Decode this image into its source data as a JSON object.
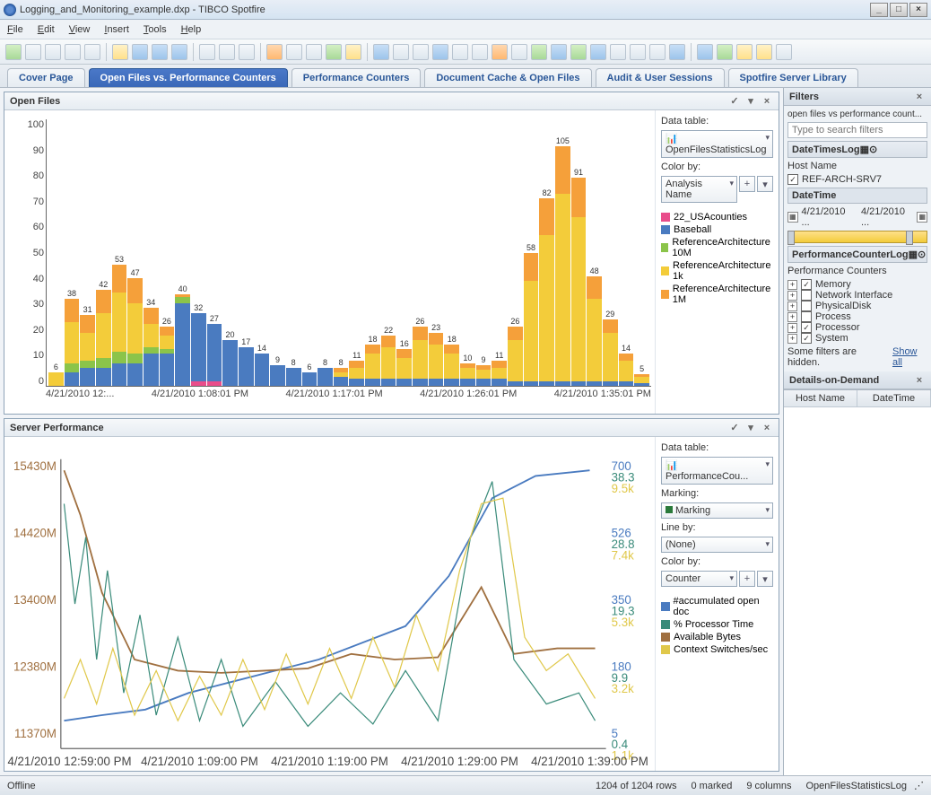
{
  "window": {
    "title": "Logging_and_Monitoring_example.dxp - TIBCO Spotfire"
  },
  "menu": {
    "items": [
      "File",
      "Edit",
      "View",
      "Insert",
      "Tools",
      "Help"
    ]
  },
  "tabs": {
    "items": [
      "Cover Page",
      "Open Files vs. Performance Counters",
      "Performance Counters",
      "Document Cache & Open Files",
      "Audit & User Sessions",
      "Spotfire Server Library"
    ],
    "active": 1
  },
  "panel_top": {
    "title": "Open Files",
    "data_table_label": "Data table:",
    "data_table": "OpenFilesStatisticsLog",
    "color_by_label": "Color by:",
    "color_by": "Analysis Name",
    "legend": [
      "22_USAcounties",
      "Baseball",
      "ReferenceArchitecture 10M",
      "ReferenceArchitecture 1k",
      "ReferenceArchitecture 1M"
    ]
  },
  "panel_bot": {
    "title": "Server Performance",
    "data_table_label": "Data table:",
    "data_table": "PerformanceCou...",
    "marking_label": "Marking:",
    "marking": "Marking",
    "line_by_label": "Line by:",
    "line_by": "(None)",
    "color_by_label": "Color by:",
    "color_by": "Counter",
    "legend": [
      "#accumulated open doc",
      "% Processor Time",
      "Available Bytes",
      "Context Switches/sec"
    ]
  },
  "filters": {
    "title": "Filters",
    "scheme": "open files vs performance count...",
    "search_placeholder": "Type to search filters",
    "group1": "DateTimesLog",
    "hostname_label": "Host Name",
    "hostname": "REF-ARCH-SRV7",
    "datetime_label": "DateTime",
    "date_from": "4/21/2010 ...",
    "date_to": "4/21/2010 ...",
    "group2": "PerformanceCounterLog",
    "counters_label": "Performance Counters",
    "counters": [
      {
        "label": "Memory",
        "checked": true
      },
      {
        "label": "Network Interface",
        "checked": false
      },
      {
        "label": "PhysicalDisk",
        "checked": false
      },
      {
        "label": "Process",
        "checked": false
      },
      {
        "label": "Processor",
        "checked": true
      },
      {
        "label": "System",
        "checked": true
      }
    ],
    "hidden_msg": "Some filters are hidden.",
    "show_all": "Show all"
  },
  "dod": {
    "title": "Details-on-Demand",
    "cols": [
      "Host Name",
      "DateTime"
    ]
  },
  "status": {
    "offline": "Offline",
    "rows": "1204 of 1204 rows",
    "marked": "0 marked",
    "columns": "9 columns",
    "table": "OpenFilesStatisticsLog"
  },
  "chart_data": [
    {
      "type": "bar",
      "title": "Open Files",
      "ylim": [
        0,
        110
      ],
      "yticks": [
        0,
        10,
        20,
        30,
        40,
        50,
        60,
        70,
        80,
        90,
        100
      ],
      "xticks": [
        "4/21/2010 12:...",
        "4/21/2010 1:08:01 PM",
        "4/21/2010 1:17:01 PM",
        "4/21/2010 1:26:01 PM",
        "4/21/2010 1:35:01 PM"
      ],
      "legend": [
        "22_USAcounties",
        "Baseball",
        "ReferenceArchitecture 10M",
        "ReferenceArchitecture 1k",
        "ReferenceArchitecture 1M"
      ],
      "bars": [
        {
          "total": 6,
          "segs": [
            0,
            0,
            0,
            6,
            0
          ]
        },
        {
          "total": 38,
          "segs": [
            0,
            6,
            4,
            18,
            10
          ]
        },
        {
          "total": 31,
          "segs": [
            0,
            8,
            3,
            12,
            8
          ]
        },
        {
          "total": 42,
          "segs": [
            0,
            8,
            4,
            20,
            10
          ]
        },
        {
          "total": 53,
          "segs": [
            0,
            10,
            5,
            26,
            12
          ]
        },
        {
          "total": 47,
          "segs": [
            0,
            10,
            4,
            22,
            11
          ]
        },
        {
          "total": 34,
          "segs": [
            0,
            14,
            3,
            10,
            7
          ]
        },
        {
          "total": 26,
          "segs": [
            0,
            14,
            2,
            6,
            4
          ]
        },
        {
          "total": 40,
          "segs": [
            0,
            36,
            3,
            0,
            1
          ]
        },
        {
          "total": 32,
          "segs": [
            2,
            30,
            0,
            0,
            0
          ]
        },
        {
          "total": 27,
          "segs": [
            2,
            25,
            0,
            0,
            0
          ]
        },
        {
          "total": 20,
          "segs": [
            0,
            20,
            0,
            0,
            0
          ]
        },
        {
          "total": 17,
          "segs": [
            0,
            17,
            0,
            0,
            0
          ]
        },
        {
          "total": 14,
          "segs": [
            0,
            14,
            0,
            0,
            0
          ]
        },
        {
          "total": 9,
          "segs": [
            0,
            9,
            0,
            0,
            0
          ]
        },
        {
          "total": 8,
          "segs": [
            0,
            8,
            0,
            0,
            0
          ]
        },
        {
          "total": 6,
          "segs": [
            0,
            6,
            0,
            0,
            0
          ]
        },
        {
          "total": 8,
          "segs": [
            0,
            8,
            0,
            0,
            0
          ]
        },
        {
          "total": 8,
          "segs": [
            0,
            4,
            0,
            2,
            2
          ]
        },
        {
          "total": 11,
          "segs": [
            0,
            3,
            0,
            5,
            3
          ]
        },
        {
          "total": 18,
          "segs": [
            0,
            3,
            0,
            11,
            4
          ]
        },
        {
          "total": 22,
          "segs": [
            0,
            3,
            0,
            14,
            5
          ]
        },
        {
          "total": 16,
          "segs": [
            0,
            3,
            0,
            9,
            4
          ]
        },
        {
          "total": 26,
          "segs": [
            0,
            3,
            0,
            17,
            6
          ]
        },
        {
          "total": 23,
          "segs": [
            0,
            3,
            0,
            15,
            5
          ]
        },
        {
          "total": 18,
          "segs": [
            0,
            3,
            0,
            11,
            4
          ]
        },
        {
          "total": 10,
          "segs": [
            0,
            3,
            0,
            5,
            2
          ]
        },
        {
          "total": 9,
          "segs": [
            0,
            3,
            0,
            4,
            2
          ]
        },
        {
          "total": 11,
          "segs": [
            0,
            3,
            0,
            5,
            3
          ]
        },
        {
          "total": 26,
          "segs": [
            0,
            2,
            0,
            18,
            6
          ]
        },
        {
          "total": 58,
          "segs": [
            0,
            2,
            0,
            44,
            12
          ]
        },
        {
          "total": 82,
          "segs": [
            0,
            2,
            0,
            64,
            16
          ]
        },
        {
          "total": 105,
          "segs": [
            0,
            2,
            0,
            82,
            21
          ]
        },
        {
          "total": 91,
          "segs": [
            0,
            2,
            0,
            72,
            17
          ]
        },
        {
          "total": 48,
          "segs": [
            0,
            2,
            0,
            36,
            10
          ]
        },
        {
          "total": 29,
          "segs": [
            0,
            2,
            0,
            21,
            6
          ]
        },
        {
          "total": 14,
          "segs": [
            0,
            2,
            0,
            9,
            3
          ]
        },
        {
          "total": 5,
          "segs": [
            0,
            1,
            0,
            3,
            1
          ]
        }
      ]
    },
    {
      "type": "line",
      "title": "Server Performance",
      "xticks": [
        "4/21/2010 12:59:00 PM",
        "4/21/2010 1:09:00 PM",
        "4/21/2010 1:19:00 PM",
        "4/21/2010 1:29:00 PM",
        "4/21/2010 1:39:00 PM"
      ],
      "y_left": [
        11370,
        12380,
        13400,
        14420,
        15430
      ],
      "y_left_unit": "M",
      "y_right_1": [
        5,
        180,
        350,
        526,
        700
      ],
      "y_right_2": [
        0.4,
        9.9,
        19.3,
        28.8,
        38.3
      ],
      "y_right_3": [
        "1.1k",
        "3.2k",
        "5.3k",
        "7.4k",
        "9.5k"
      ],
      "series": [
        {
          "name": "#accumulated open doc",
          "color": "#4a7bc0"
        },
        {
          "name": "% Processor Time",
          "color": "#3a8b7a"
        },
        {
          "name": "Available Bytes",
          "color": "#a07040"
        },
        {
          "name": "Context Switches/sec",
          "color": "#e0c84a"
        }
      ]
    }
  ]
}
